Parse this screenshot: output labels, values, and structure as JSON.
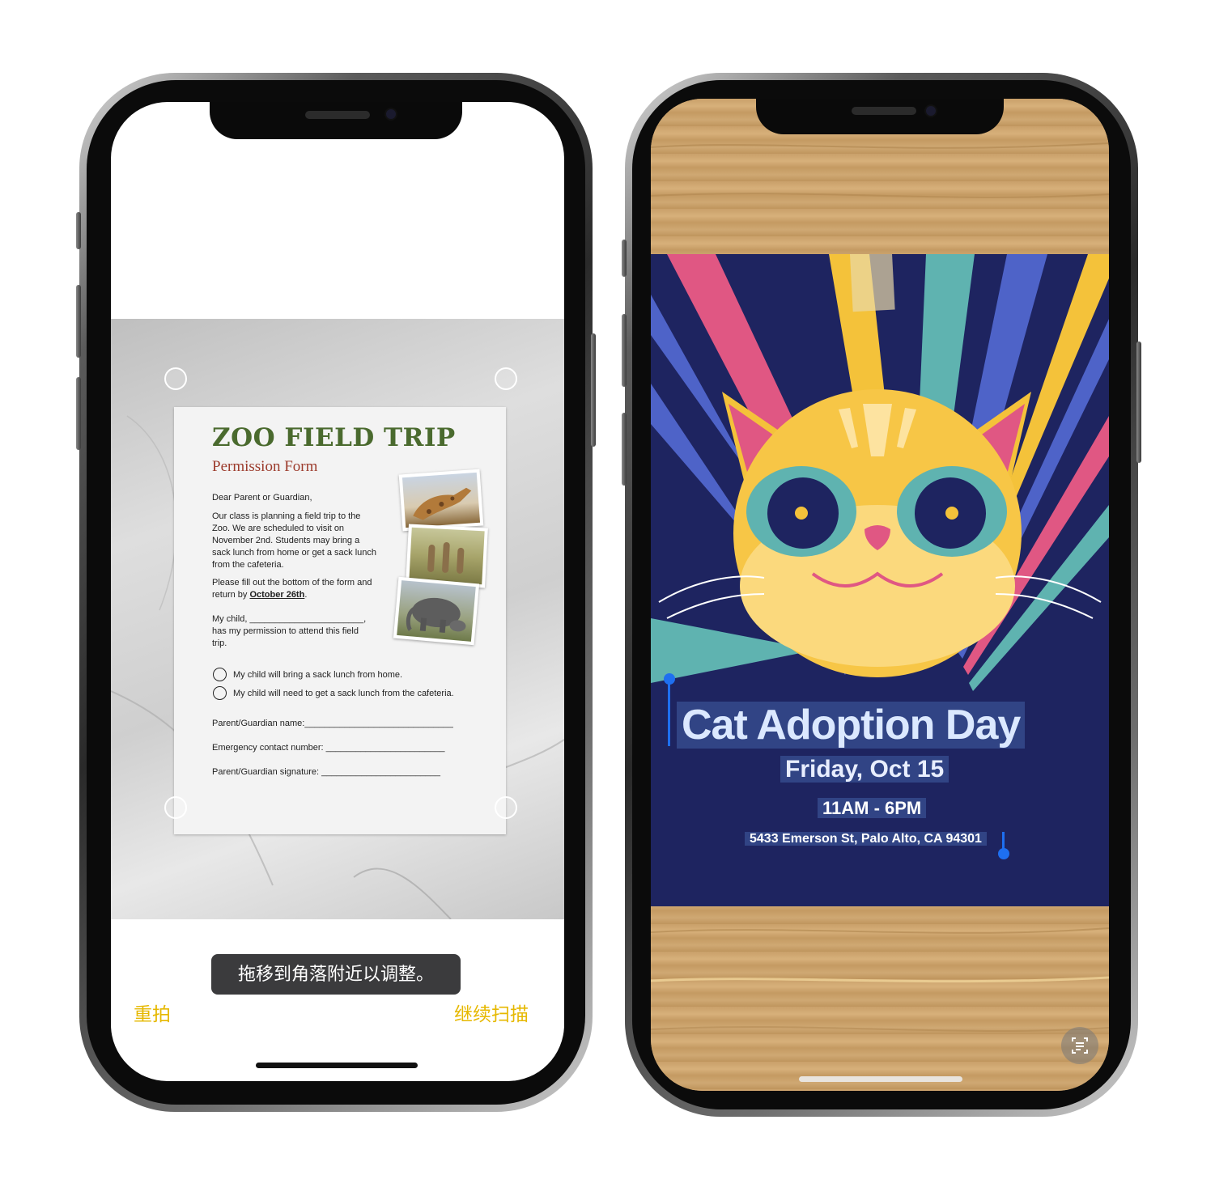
{
  "left_phone": {
    "document": {
      "title": "ZOO FIELD TRIP",
      "subtitle": "Permission Form",
      "greeting": "Dear Parent or Guardian,",
      "paragraph1": "Our class is planning a field trip to the Zoo. We are scheduled to visit on November 2nd. Students may bring a sack lunch from home or get a sack lunch from the cafeteria.",
      "paragraph2_prefix": "Please fill out the bottom of the form and return by ",
      "paragraph2_date": "October 26th",
      "paragraph2_suffix": ".",
      "child_line": "My child, _______________________,",
      "permission_line": "has my permission to attend this field trip.",
      "options": [
        "My child will bring a sack lunch from home.",
        "My child will need to get a sack lunch from the cafeteria."
      ],
      "fields": [
        "Parent/Guardian name:______________________________",
        "Emergency contact number: ________________________",
        "Parent/Guardian signature: ________________________"
      ]
    },
    "toast": "拖移到角落附近以调整。",
    "retake_button": "重拍",
    "continue_button": "继续扫描"
  },
  "right_phone": {
    "poster": {
      "headline": "Cat Adoption Day",
      "date": "Friday, Oct 15",
      "time": "11AM - 6PM",
      "address": "5433 Emerson St, Palo Alto, CA 94301"
    },
    "live_text_icon": "live-text-scan-icon"
  },
  "colors": {
    "title_green": "#4a6a2e",
    "subtitle_red": "#9c3b2c",
    "action_yellow": "#e6b800",
    "poster_navy": "#1e2460",
    "selection_blue": "#1e6ff0"
  }
}
